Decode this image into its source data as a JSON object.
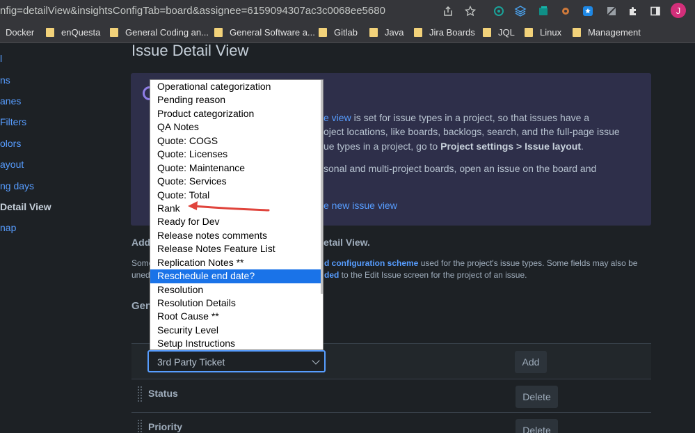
{
  "browser": {
    "url": "nfig=detailView&insightsConfigTab=board&assignee=6159094307ac3c0068ee5680",
    "profile_initial": "J",
    "bookmarks": [
      "Docker",
      "enQuesta",
      "General Coding an...",
      "General Software a...",
      "Gitlab",
      "Java",
      "Jira Boards",
      "JQL",
      "Linux",
      "Management"
    ]
  },
  "sidebar": {
    "items": [
      {
        "label": "l"
      },
      {
        "label": "ns"
      },
      {
        "label": "anes"
      },
      {
        "label": "Filters"
      },
      {
        "label": "olors"
      },
      {
        "label": "ayout"
      },
      {
        "label": "ng days"
      },
      {
        "label": "Detail View"
      },
      {
        "label": "nap"
      }
    ]
  },
  "main": {
    "title": "Issue Detail View",
    "info": {
      "line1_link": "e view",
      "line1_rest": " is set for issue types in a project, so that issues have a",
      "line2": "oject locations, like boards, backlogs, search, and the full-page issue",
      "line3_pre": "ue types in a project, go to ",
      "line3_bold": "Project settings > Issue layout",
      "line3_post": ".",
      "line4": "sonal and multi-project boards, open an issue on the board and",
      "line5_link": "e new issue view"
    },
    "add_heading_left": "Add",
    "add_heading_right": "etail View.",
    "desc_left1": "Some",
    "desc_link1": "d configuration scheme",
    "desc_rest1": " used for the project's issue types. Some fields may also be",
    "desc_left2": "uned",
    "desc_link2": "ded",
    "desc_rest2": " to the Edit Issue screen for the project of an issue.",
    "section_heading": "Gen",
    "select_value": "3rd Party Ticket",
    "add_button": "Add",
    "rows": [
      {
        "label": "Status",
        "button": "Delete"
      },
      {
        "label": "Priority",
        "button": "Delete"
      }
    ]
  },
  "dropdown": {
    "options": [
      "Operational categorization",
      "Pending reason",
      "Product categorization",
      "QA Notes",
      "Quote: COGS",
      "Quote: Licenses",
      "Quote: Maintenance",
      "Quote: Services",
      "Quote: Total",
      "Rank",
      "Ready for Dev",
      "Release notes comments",
      "Release Notes Feature List",
      "Replication Notes **",
      "Reschedule end date?",
      "Resolution",
      "Resolution Details",
      "Root Cause **",
      "Security Level",
      "Setup Instructions"
    ],
    "highlighted": "Reschedule end date?"
  },
  "colors": {
    "highlight": "#1a73e8",
    "annotation_arrow": "#e0443c",
    "link": "#579dff"
  }
}
